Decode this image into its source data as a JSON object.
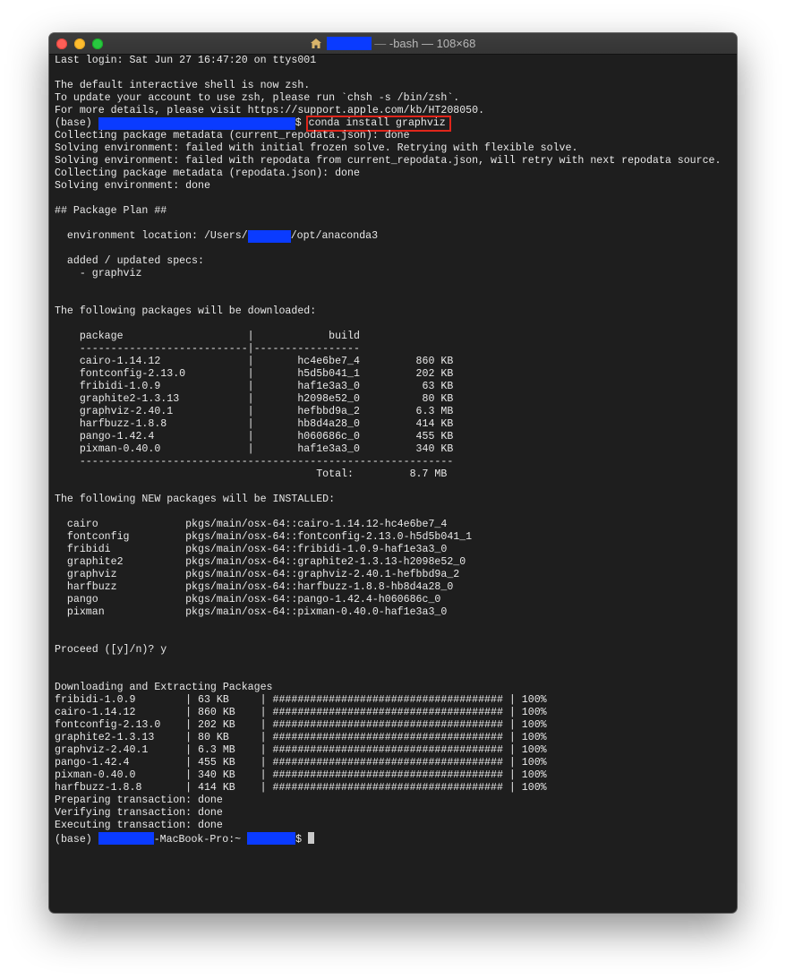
{
  "window": {
    "title": "-bash — 108×68"
  },
  "terminal": {
    "intro": [
      "Last login: Sat Jun 27 16:47:20 on ttys001",
      "",
      "The default interactive shell is now zsh.",
      "To update your account to use zsh, please run `chsh -s /bin/zsh`.",
      "For more details, please visit https://support.apple.com/kb/HT208050."
    ],
    "prompt": {
      "prefix": "(base) ",
      "suffix": "$ ",
      "command": "conda install graphviz"
    },
    "solve": [
      "Collecting package metadata (current_repodata.json): done",
      "Solving environment: failed with initial frozen solve. Retrying with flexible solve.",
      "Solving environment: failed with repodata from current_repodata.json, will retry with next repodata source.",
      "Collecting package metadata (repodata.json): done",
      "Solving environment: done",
      "",
      "## Package Plan ##",
      ""
    ],
    "env_location_prefix": "  environment location: /Users/",
    "env_location_suffix": "/opt/anaconda3",
    "specs": [
      "",
      "  added / updated specs:",
      "    - graphviz",
      "",
      "",
      "The following packages will be downloaded:",
      ""
    ],
    "download_header": "    package                    |            build",
    "download_rule": "    ---------------------------|-----------------",
    "downloads": [
      {
        "package": "cairo-1.14.12",
        "build": "hc4e6be7_4",
        "size": "860 KB"
      },
      {
        "package": "fontconfig-2.13.0",
        "build": "h5d5b041_1",
        "size": "202 KB"
      },
      {
        "package": "fribidi-1.0.9",
        "build": "haf1e3a3_0",
        "size": "63 KB"
      },
      {
        "package": "graphite2-1.3.13",
        "build": "h2098e52_0",
        "size": "80 KB"
      },
      {
        "package": "graphviz-2.40.1",
        "build": "hefbbd9a_2",
        "size": "6.3 MB"
      },
      {
        "package": "harfbuzz-1.8.8",
        "build": "hb8d4a28_0",
        "size": "414 KB"
      },
      {
        "package": "pango-1.42.4",
        "build": "h060686c_0",
        "size": "455 KB"
      },
      {
        "package": "pixman-0.40.0",
        "build": "haf1e3a3_0",
        "size": "340 KB"
      }
    ],
    "total_rule": "    ------------------------------------------------------------",
    "total_label": "Total:",
    "total_value": "8.7 MB",
    "new_header": "The following NEW packages will be INSTALLED:",
    "installs": [
      {
        "name": "cairo",
        "spec": "pkgs/main/osx-64::cairo-1.14.12-hc4e6be7_4"
      },
      {
        "name": "fontconfig",
        "spec": "pkgs/main/osx-64::fontconfig-2.13.0-h5d5b041_1"
      },
      {
        "name": "fribidi",
        "spec": "pkgs/main/osx-64::fribidi-1.0.9-haf1e3a3_0"
      },
      {
        "name": "graphite2",
        "spec": "pkgs/main/osx-64::graphite2-1.3.13-h2098e52_0"
      },
      {
        "name": "graphviz",
        "spec": "pkgs/main/osx-64::graphviz-2.40.1-hefbbd9a_2"
      },
      {
        "name": "harfbuzz",
        "spec": "pkgs/main/osx-64::harfbuzz-1.8.8-hb8d4a28_0"
      },
      {
        "name": "pango",
        "spec": "pkgs/main/osx-64::pango-1.42.4-h060686c_0"
      },
      {
        "name": "pixman",
        "spec": "pkgs/main/osx-64::pixman-0.40.0-haf1e3a3_0"
      }
    ],
    "proceed": "Proceed ([y]/n)? y",
    "dl_header": "Downloading and Extracting Packages",
    "progress": [
      {
        "name": "fribidi-1.0.9",
        "size": "63 KB",
        "percent": "100%"
      },
      {
        "name": "cairo-1.14.12",
        "size": "860 KB",
        "percent": "100%"
      },
      {
        "name": "fontconfig-2.13.0",
        "size": "202 KB",
        "percent": "100%"
      },
      {
        "name": "graphite2-1.3.13",
        "size": "80 KB",
        "percent": "100%"
      },
      {
        "name": "graphviz-2.40.1",
        "size": "6.3 MB",
        "percent": "100%"
      },
      {
        "name": "pango-1.42.4",
        "size": "455 KB",
        "percent": "100%"
      },
      {
        "name": "pixman-0.40.0",
        "size": "340 KB",
        "percent": "100%"
      },
      {
        "name": "harfbuzz-1.8.8",
        "size": "414 KB",
        "percent": "100%"
      }
    ],
    "progress_bar": "#####################################",
    "transaction": [
      "Preparing transaction: done",
      "Verifying transaction: done",
      "Executing transaction: done"
    ],
    "final_prompt": {
      "prefix": "(base) ",
      "middle": "-MacBook-Pro:~ ",
      "suffix": "$ "
    }
  },
  "colors": {
    "terminal_bg": "#1e1e1e",
    "text": "#e9e9e9",
    "redaction": "#0a3bff",
    "highlight_box": "#e0261b"
  }
}
